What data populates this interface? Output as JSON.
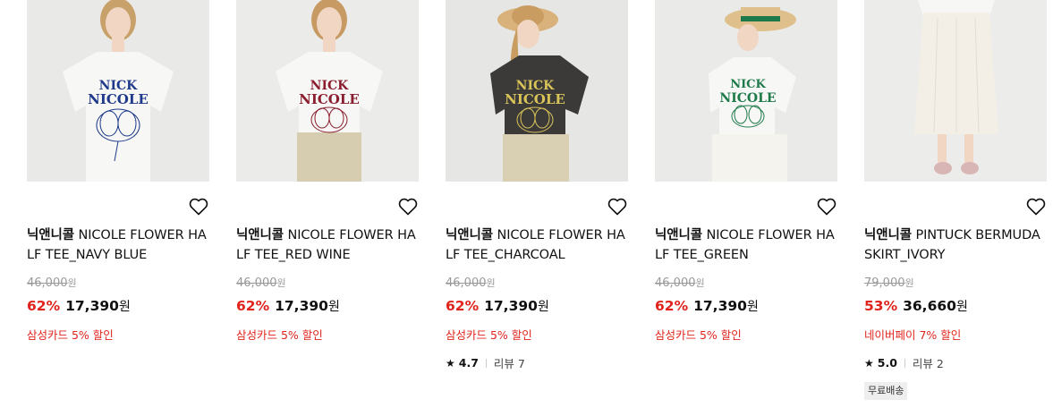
{
  "products": [
    {
      "brand": "닉앤니콜",
      "name": "NICOLE FLOWER HALF TEE_NAVY BLUE",
      "original_price": "46,000",
      "currency_small": "원",
      "discount_rate": "62%",
      "sale_price": "17,390",
      "currency": "원",
      "promo": "삼성카드 5% 할인",
      "rating": null,
      "reviews": null,
      "badge": null,
      "print_color": "#1e3a8a",
      "shirt_color": "#f5f5f3",
      "print_text": "NICK NICOLE"
    },
    {
      "brand": "닉앤니콜",
      "name": "NICOLE FLOWER HALF TEE_RED WINE",
      "original_price": "46,000",
      "currency_small": "원",
      "discount_rate": "62%",
      "sale_price": "17,390",
      "currency": "원",
      "promo": "삼성카드 5% 할인",
      "rating": null,
      "reviews": null,
      "badge": null,
      "print_color": "#8b1e2e",
      "shirt_color": "#f5f5f3",
      "print_text": "NICK NICOLE"
    },
    {
      "brand": "닉앤니콜",
      "name": "NICOLE FLOWER HALF TEE_CHARCOAL",
      "original_price": "46,000",
      "currency_small": "원",
      "discount_rate": "62%",
      "sale_price": "17,390",
      "currency": "원",
      "promo": "삼성카드 5% 할인",
      "rating": "4.7",
      "reviews": "리뷰 7",
      "badge": null,
      "print_color": "#d9c45a",
      "shirt_color": "#3b3a38",
      "print_text": "NICK NICOLE"
    },
    {
      "brand": "닉앤니콜",
      "name": "NICOLE FLOWER HALF TEE_GREEN",
      "original_price": "46,000",
      "currency_small": "원",
      "discount_rate": "62%",
      "sale_price": "17,390",
      "currency": "원",
      "promo": "삼성카드 5% 할인",
      "rating": null,
      "reviews": null,
      "badge": null,
      "print_color": "#1e7a4a",
      "shirt_color": "#f5f5f3",
      "print_text": "NICK NICOLE"
    },
    {
      "brand": "닉앤니콜",
      "name": "PINTUCK BERMUDA SKIRT_IVORY",
      "original_price": "79,000",
      "currency_small": "원",
      "discount_rate": "53%",
      "sale_price": "36,660",
      "currency": "원",
      "promo": "네이버페이 7% 할인",
      "rating": "5.0",
      "reviews": "리뷰 2",
      "badge": "무료배송",
      "print_color": "#f3efe6",
      "shirt_color": "#f3efe6",
      "print_text": ""
    }
  ],
  "colors": {
    "discount": "#e0241c",
    "strike": "#999999",
    "background": "#ffffff"
  }
}
